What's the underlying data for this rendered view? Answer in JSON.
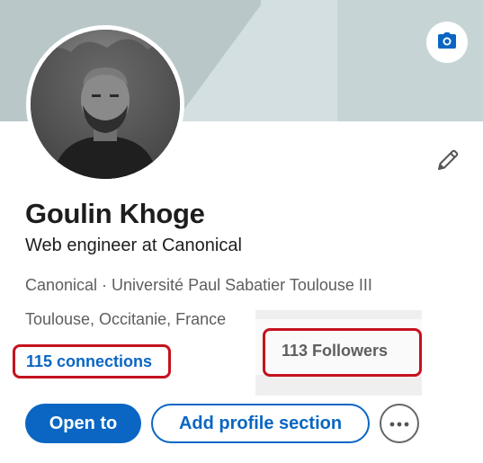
{
  "profile": {
    "name": "Goulin Khoge",
    "headline": "Web engineer at Canonical",
    "organizations": "Canonical · Université Paul Sabatier Toulouse III",
    "location": "Toulouse, Occitanie, France",
    "connections": "115 connections",
    "followers": "113 Followers"
  },
  "actions": {
    "open_to": "Open to",
    "add_profile_section": "Add profile section"
  },
  "icons": {
    "camera": "camera-icon",
    "edit": "pencil-icon",
    "more": "ellipsis-icon"
  },
  "colors": {
    "accent": "#0a66c2",
    "highlight_box": "#c5121e",
    "banner": "#b9c7c9"
  }
}
